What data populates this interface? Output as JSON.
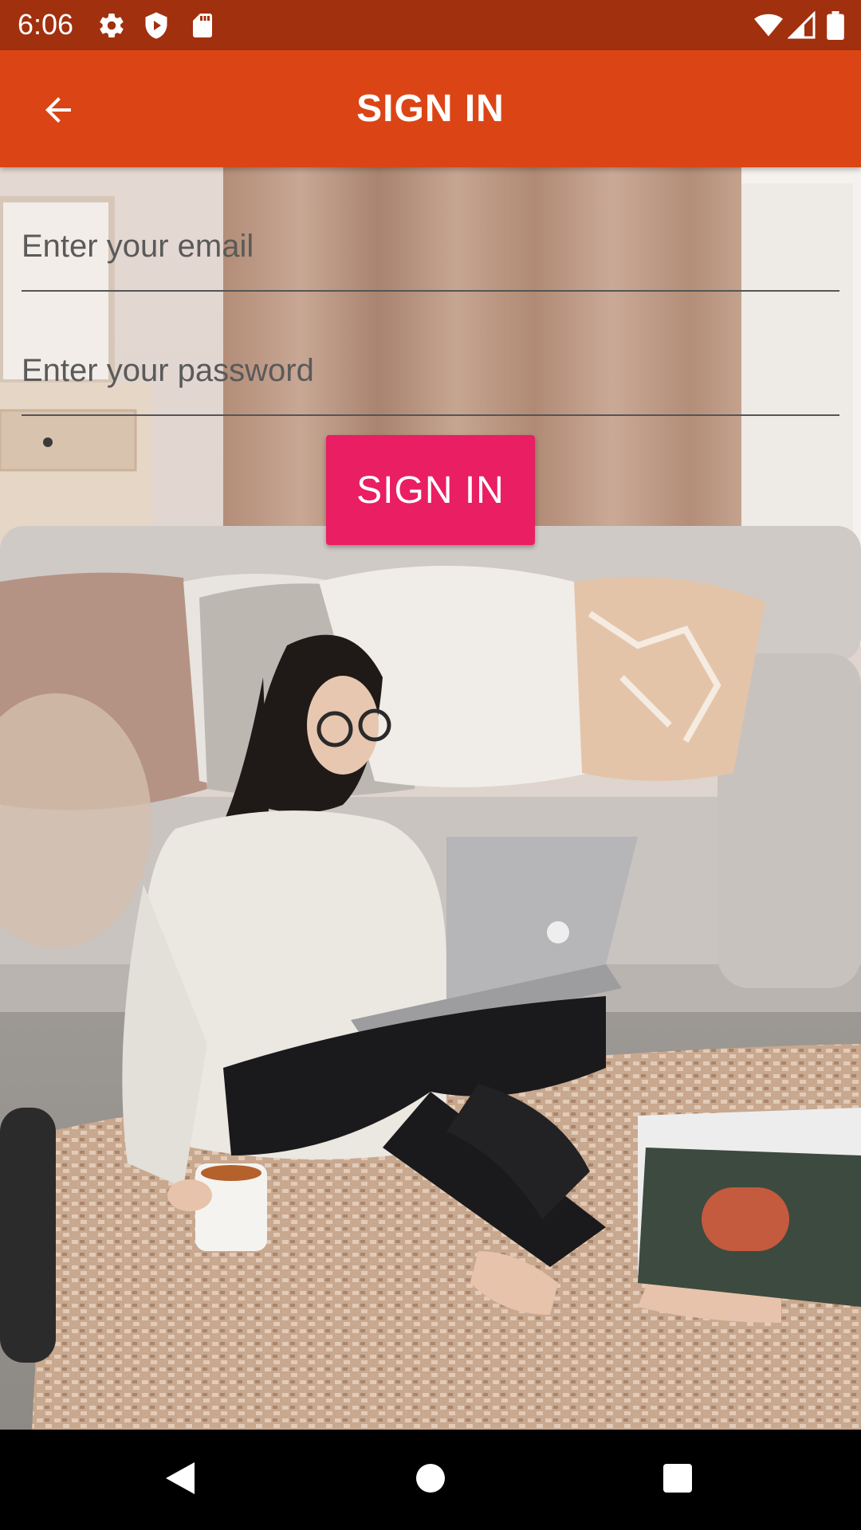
{
  "status_bar": {
    "time": "6:06",
    "left_icons": [
      "settings-icon",
      "shield-icon",
      "sd-card-icon"
    ],
    "right_icons": [
      "wifi-icon",
      "cell-signal-icon",
      "battery-icon"
    ],
    "background": "#A1300F"
  },
  "app_bar": {
    "title": "SIGN IN",
    "back_icon": "arrow-back-icon",
    "background": "#DB4515"
  },
  "form": {
    "email_placeholder": "Enter your email",
    "email_value": "",
    "password_placeholder": "Enter your password",
    "password_value": "",
    "submit_label": "SIGN IN",
    "submit_color": "#E91E63"
  },
  "nav_bar": {
    "buttons": [
      "back-triangle-icon",
      "home-circle-icon",
      "recents-square-icon"
    ]
  }
}
